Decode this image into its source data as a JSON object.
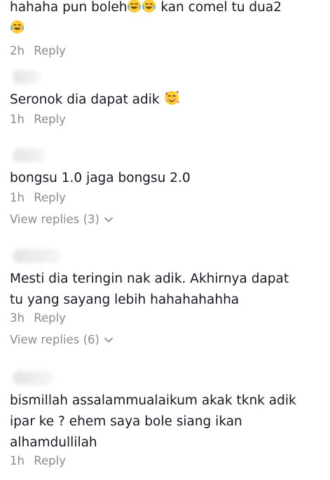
{
  "comments": [
    {
      "text_before": "hahaha pun boleh",
      "text_after": " kan comel tu dua2",
      "time": "2h",
      "reply": "Reply",
      "emoji": [
        "face-with-tears-of-joy",
        "face-with-tears-of-joy",
        "face-with-tears-of-joy"
      ]
    },
    {
      "text": "Seronok dia dapat adik ",
      "time": "1h",
      "reply": "Reply",
      "emoji": [
        "smiling-face-with-hearts"
      ]
    },
    {
      "text": "bongsu 1.0 jaga bongsu 2.0",
      "time": "1h",
      "reply": "Reply",
      "view_replies": "View replies (3)"
    },
    {
      "text": "Mesti dia teringin nak adik. Akhirnya dapat tu yang sayang lebih hahahahahha",
      "time": "3h",
      "reply": "Reply",
      "view_replies": "View replies (6)"
    },
    {
      "text": "bismillah assalammualaikum akak tknk adik ipar ke ? ehem saya bole siang ikan alhamdullilah",
      "time": "1h",
      "reply": "Reply"
    }
  ],
  "colors": {
    "text": "#161823",
    "meta": "#8a8b91",
    "emoji_face": "#ffcc33"
  }
}
